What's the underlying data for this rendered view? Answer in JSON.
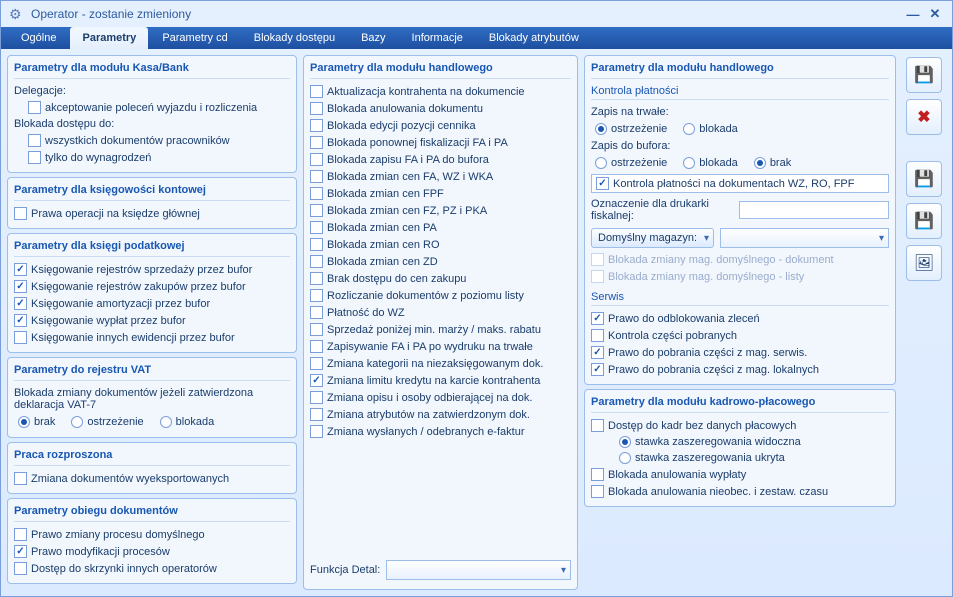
{
  "window": {
    "title": "Operator - zostanie zmieniony"
  },
  "tabs": [
    "Ogólne",
    "Parametry",
    "Parametry cd",
    "Blokady dostępu",
    "Bazy",
    "Informacje",
    "Blokady atrybutów"
  ],
  "activeTab": 1,
  "col1": {
    "g1": {
      "title": "Parametry dla modułu Kasa/Bank",
      "delegLabel": "Delegacje:",
      "c1": "akceptowanie poleceń wyjazdu i rozliczenia",
      "blokLabel": "Blokada dostępu do:",
      "c2": "wszystkich dokumentów pracowników",
      "c3": "tylko do wynagrodzeń"
    },
    "g2": {
      "title": "Parametry dla księgowości kontowej",
      "c1": "Prawa operacji na księdze głównej"
    },
    "g3": {
      "title": "Parametry dla księgi podatkowej",
      "c1": "Księgowanie rejestrów sprzedaży przez bufor",
      "c2": "Księgowanie rejestrów zakupów przez bufor",
      "c3": "Księgowanie amortyzacji przez bufor",
      "c4": "Księgowanie wypłat przez bufor",
      "c5": "Księgowanie innych ewidencji przez bufor"
    },
    "g4": {
      "title": "Parametry do rejestru VAT",
      "text": "Blokada zmiany dokumentów jeżeli zatwierdzona deklaracja VAT-7",
      "r1": "brak",
      "r2": "ostrzeżenie",
      "r3": "blokada"
    },
    "g5": {
      "title": "Praca rozproszona",
      "c1": "Zmiana dokumentów wyeksportowanych"
    },
    "g6": {
      "title": "Parametry obiegu dokumentów",
      "c1": "Prawo zmiany procesu domyślnego",
      "c2": "Prawo modyfikacji procesów",
      "c3": "Dostęp do skrzynki innych operatorów"
    }
  },
  "col2": {
    "title": "Parametry dla modułu handlowego",
    "items": [
      "Aktualizacja kontrahenta na dokumencie",
      "Blokada anulowania dokumentu",
      "Blokada edycji pozycji cennika",
      "Blokada ponownej fiskalizacji FA i PA",
      "Blokada zapisu FA i PA do bufora",
      "Blokada zmian cen FA, WZ i WKA",
      "Blokada zmian cen FPF",
      "Blokada zmian cen FZ, PZ i PKA",
      "Blokada zmian cen PA",
      "Blokada zmian cen RO",
      "Blokada zmian cen ZD",
      "Brak dostępu do cen zakupu",
      "Rozliczanie dokumentów z poziomu listy",
      "Płatność do WZ",
      "Sprzedaż poniżej min. marży / maks. rabatu",
      "Zapisywanie FA i PA po wydruku na trwałe",
      "Zmiana kategorii na niezaksięgowanym dok.",
      "Zmiana limitu kredytu na karcie kontrahenta",
      "Zmiana opisu i osoby odbierającej na dok.",
      "Zmiana atrybutów na zatwierdzonym dok.",
      "Zmiana wysłanych / odebranych e-faktur"
    ],
    "checked": [
      17
    ],
    "funkcjaLabel": "Funkcja Detal:"
  },
  "col3": {
    "g1": {
      "title": "Parametry dla modułu handlowego",
      "kontrola": "Kontrola płatności",
      "zapisTrwale": "Zapis na trwałe:",
      "zapisBufor": "Zapis do bufora:",
      "r_ostrz": "ostrzeżenie",
      "r_blok": "blokada",
      "r_brak": "brak",
      "cKontrola": "Kontrola płatności na dokumentach WZ, RO, FPF",
      "oznaczenie": "Oznaczenie dla drukarki fiskalnej:",
      "magazynBtn": "Domyślny magazyn:",
      "disabled1": "Blokada zmiany mag. domyślnego - dokument",
      "disabled2": "Blokada zmiany mag. domyślnego - listy",
      "serwis": "Serwis",
      "s1": "Prawo do odblokowania zleceń",
      "s2": "Kontrola części pobranych",
      "s3": "Prawo do pobrania części z mag. serwis.",
      "s4": "Prawo do pobrania części z mag. lokalnych"
    },
    "g2": {
      "title": "Parametry dla modułu kadrowo-płacowego",
      "c1": "Dostęp do kadr bez danych płacowych",
      "r1": "stawka zaszeregowania widoczna",
      "r2": "stawka zaszeregowania ukryta",
      "c2": "Blokada anulowania wypłaty",
      "c3": "Blokada anulowania nieobec. i zestaw. czasu"
    }
  }
}
